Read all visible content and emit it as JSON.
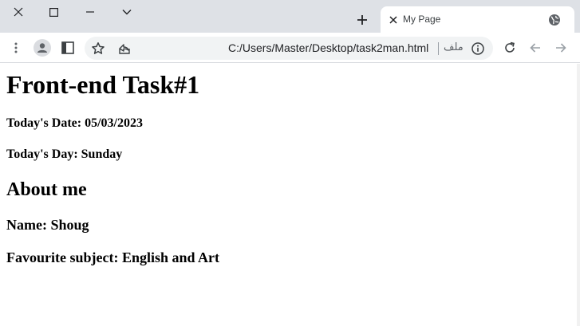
{
  "window": {
    "tab_title": "My Page",
    "url": "C:/Users/Master/Desktop/task2man.html",
    "site_label": "ملف"
  },
  "icons": {
    "close": "close-icon",
    "maximize": "maximize-icon",
    "minimize": "minimize-icon",
    "tab_search": "chevron-down-icon",
    "new_tab": "plus-icon",
    "tab_close": "close-icon",
    "favicon": "globe-icon",
    "menu": "kebab-menu-icon",
    "profile": "profile-icon",
    "side_panel": "side-panel-icon",
    "bookmark": "star-icon",
    "share": "share-icon",
    "info": "info-icon",
    "reload": "reload-icon",
    "back": "back-arrow-icon",
    "forward": "forward-arrow-icon"
  },
  "page": {
    "heading": "Front-end Task#1",
    "date_line": "Today's Date: 05/03/2023",
    "day_line": "Today's Day: Sunday",
    "about_heading": "About me",
    "name_line": "Name: Shoug",
    "subject_line": "Favourite subject: English and Art"
  },
  "colors": {
    "tabstrip": "#dee1e6",
    "toolbar": "#ffffff",
    "omnibox": "#f1f3f4",
    "icon": "#5f6368",
    "text": "#000000"
  }
}
